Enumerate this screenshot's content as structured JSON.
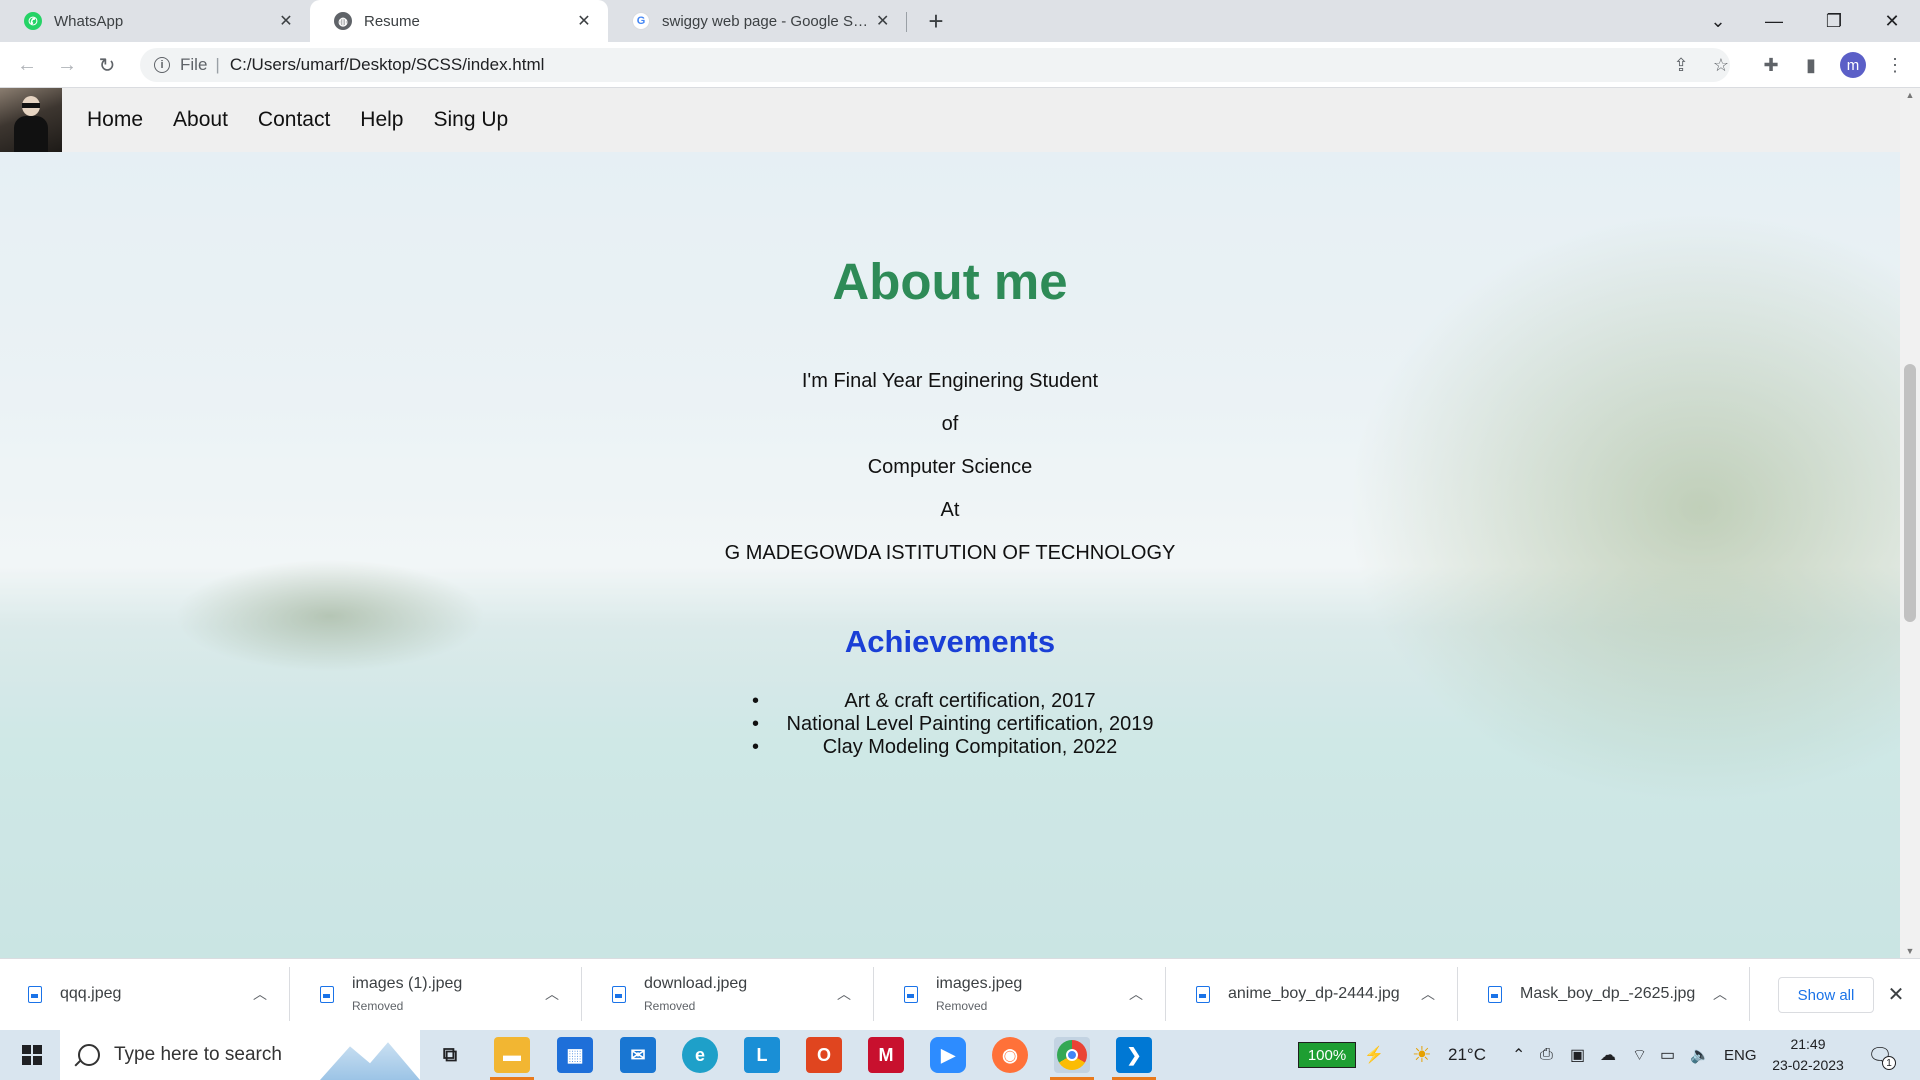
{
  "browser": {
    "tabs": [
      {
        "title": "WhatsApp",
        "icon": "whatsapp-icon",
        "icon_color": "#25d366",
        "active": false
      },
      {
        "title": "Resume",
        "icon": "globe-icon",
        "icon_color": "#5f6368",
        "active": true
      },
      {
        "title": "swiggy web page - Google Search",
        "icon": "google-icon",
        "icon_color": "#4285f4",
        "active": false
      }
    ],
    "address": {
      "scheme_label": "File",
      "url": "C:/Users/umarf/Desktop/SCSS/index.html"
    },
    "profile_initial": "m"
  },
  "page": {
    "nav": {
      "items": [
        "Home",
        "About",
        "Contact",
        "Help",
        "Sing Up"
      ]
    },
    "about": {
      "title": "About me",
      "lines": [
        "I'm Final Year Enginering Student",
        "of",
        "Computer Science",
        "At",
        "G MADEGOWDA ISTITUTION OF TECHNOLOGY"
      ],
      "title_color": "#2e8b57"
    },
    "achievements": {
      "title": "Achievements",
      "title_color": "#1a3fd6",
      "items": [
        "Art & craft certification, 2017",
        "National Level Painting certification, 2019",
        "Clay Modeling Compitation, 2022"
      ]
    }
  },
  "downloads": {
    "items": [
      {
        "name": "qqq.jpeg",
        "status": ""
      },
      {
        "name": "images (1).jpeg",
        "status": "Removed"
      },
      {
        "name": "download.jpeg",
        "status": "Removed"
      },
      {
        "name": "images.jpeg",
        "status": "Removed"
      },
      {
        "name": "anime_boy_dp-2444.jpg",
        "status": ""
      },
      {
        "name": "Mask_boy_dp_-2625.jpg",
        "status": ""
      }
    ],
    "show_all_label": "Show all"
  },
  "taskbar": {
    "search_placeholder": "Type here to search",
    "battery": "100%",
    "temperature": "21°C",
    "language": "ENG",
    "time": "21:49",
    "date": "23-02-2023",
    "notification_count": "1"
  }
}
